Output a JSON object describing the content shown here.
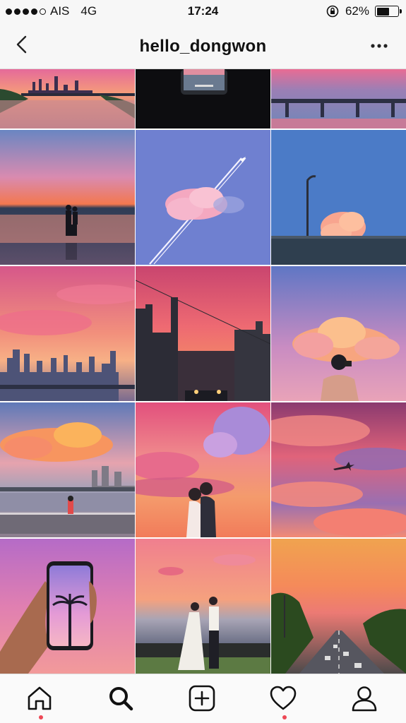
{
  "status_bar": {
    "carrier": "AIS",
    "network": "4G",
    "time": "17:24",
    "battery_text": "62%",
    "battery_level": 0.62,
    "signal_bars_filled": 4,
    "signal_bars_total": 5
  },
  "nav": {
    "title": "hello_dongwon",
    "back_icon": "chevron-left-icon",
    "more_icon": "more-horizontal-icon"
  },
  "grid": {
    "photos": [
      {
        "label": "city-river-sunset"
      },
      {
        "label": "phone-on-dark"
      },
      {
        "label": "bridge-pink-sky"
      },
      {
        "label": "couple-beach-silhouette"
      },
      {
        "label": "pink-cloud-airplane-trail"
      },
      {
        "label": "streetlight-pink-cloud"
      },
      {
        "label": "skyline-pink-clouds"
      },
      {
        "label": "street-buildings-sunset"
      },
      {
        "label": "man-photographing-cloud"
      },
      {
        "label": "riverside-orange-clouds"
      },
      {
        "label": "couple-kissing-sunset"
      },
      {
        "label": "airplane-magenta-sky"
      },
      {
        "label": "hand-holding-phone-palm"
      },
      {
        "label": "couple-wedding-beach"
      },
      {
        "label": "highway-orange-sky"
      }
    ]
  },
  "tabs": [
    {
      "name": "home",
      "icon": "home-icon",
      "notification": true
    },
    {
      "name": "search",
      "icon": "search-icon",
      "active": true
    },
    {
      "name": "add",
      "icon": "add-post-icon"
    },
    {
      "name": "activity",
      "icon": "heart-icon",
      "notification": true
    },
    {
      "name": "profile",
      "icon": "profile-icon"
    }
  ],
  "colors": {
    "notification_dot": "#ed4956",
    "bar_bg": "#f7f7f7"
  }
}
